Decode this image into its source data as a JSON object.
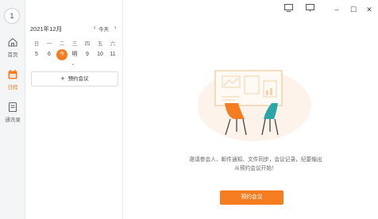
{
  "sidebar": {
    "avatar_text": "1",
    "items": [
      {
        "label": "首页",
        "icon": "home-icon"
      },
      {
        "label": "日程",
        "icon": "calendar-icon",
        "active": true
      },
      {
        "label": "通讯录",
        "icon": "contacts-icon"
      }
    ]
  },
  "calendar": {
    "month_label": "2021年12月",
    "today_label": "今天",
    "weekdays": [
      "日",
      "一",
      "二",
      "三",
      "四",
      "五",
      "六"
    ],
    "days": [
      "5",
      "6",
      "今",
      "明",
      "9",
      "10",
      "11"
    ],
    "selected_index": 2,
    "book_button": "预约会议"
  },
  "main": {
    "hint_line1": "邀请参会人、邮件通知、文件同步，会议记录，纪要输出",
    "hint_line2": "从预约会议开始！",
    "primary_button": "预约会议"
  },
  "window_controls": {
    "minimize": "–",
    "maximize": "☐",
    "close": "✕"
  },
  "colors": {
    "accent": "#f57d20",
    "rail_bg": "#f4f5f7"
  }
}
